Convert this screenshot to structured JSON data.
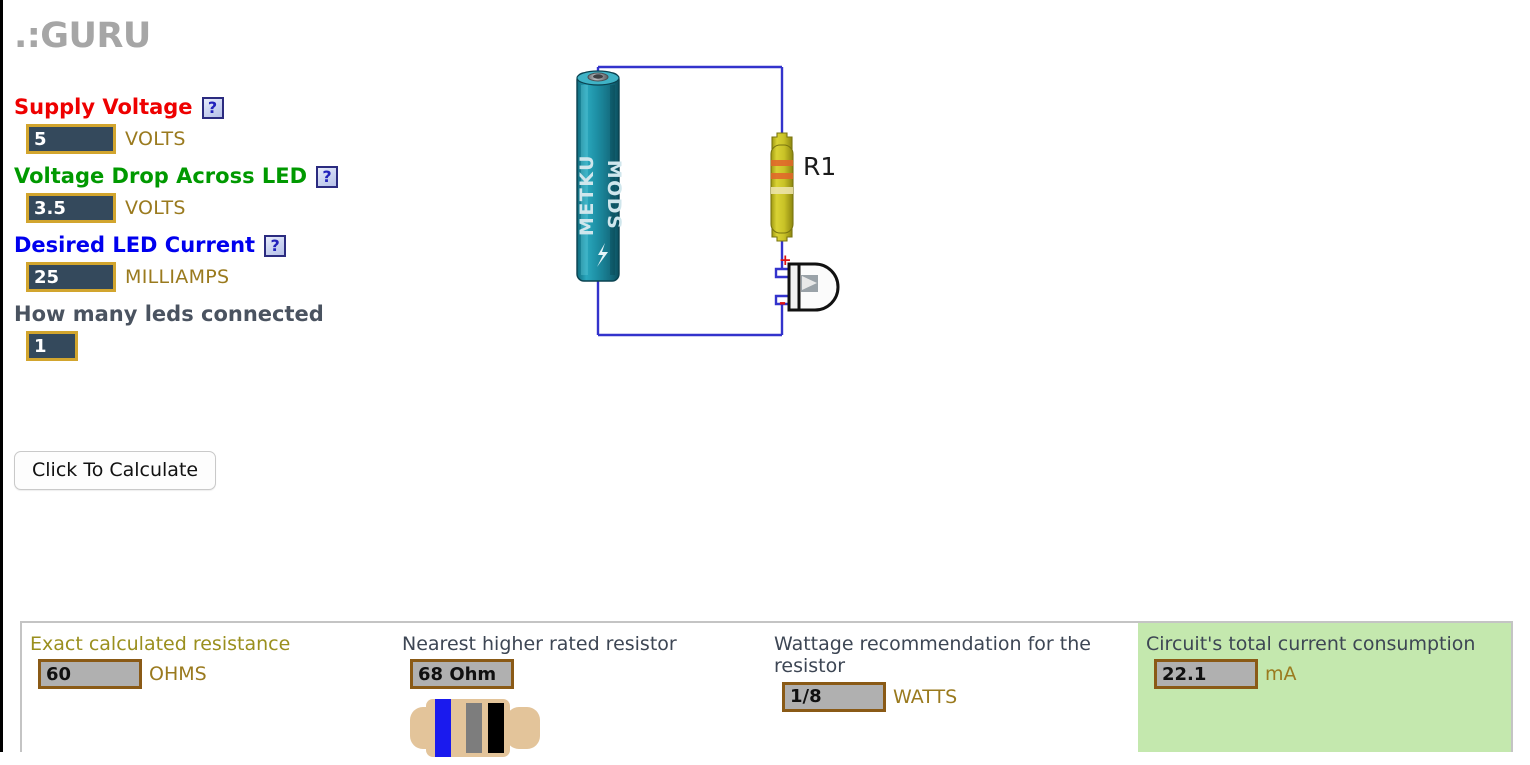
{
  "logo": {
    "text": ".:GURU"
  },
  "form": {
    "fields": [
      {
        "label": "Supply Voltage",
        "help_icon": "question-mark-icon",
        "help_text": "?",
        "value": "5",
        "unit": "VOLTS",
        "color": "#ee0000"
      },
      {
        "label": "Voltage Drop Across LED",
        "help_icon": "question-mark-icon",
        "help_text": "?",
        "value": "3.5",
        "unit": "VOLTS",
        "color": "#009900"
      },
      {
        "label": "Desired LED Current",
        "help_icon": "question-mark-icon",
        "help_text": "?",
        "value": "25",
        "unit": "MILLIAMPS",
        "color": "#0000ee"
      },
      {
        "label": "How many leds connected",
        "value": "1",
        "unit": "",
        "color": "#4a5360"
      }
    ],
    "calculate_button": "Click To Calculate"
  },
  "circuit": {
    "battery_label_line1": "METKU",
    "battery_label_line2": "MODS",
    "resistor_label": "R1",
    "led_plus": "+",
    "led_minus": "-",
    "wire_color": "#3333cc",
    "battery_color": "#1a8ca0",
    "resistor_color": "#ccc424"
  },
  "results": {
    "cells": [
      {
        "label": "Exact calculated resistance",
        "label_color": "#9a8f1e",
        "value": "60",
        "unit": "OHMS",
        "has_resistor_graphic": false,
        "background": "#ffffff"
      },
      {
        "label": "Nearest higher rated resistor",
        "label_color": "#3d4654",
        "value": "68 Ohm",
        "unit": "",
        "has_resistor_graphic": true,
        "band_colors": [
          "#1a1aee",
          "#7d7d7d",
          "#000000"
        ],
        "background": "#ffffff"
      },
      {
        "label": "Wattage recommendation for the resistor",
        "label_color": "#3d4654",
        "value": "1/8",
        "unit": "WATTS",
        "has_resistor_graphic": false,
        "background": "#ffffff"
      },
      {
        "label": "Circuit's total current consumption",
        "label_color": "#3d4654",
        "value": "22.1",
        "unit": "mA",
        "has_resistor_graphic": false,
        "background": "#c4e8ae"
      }
    ]
  }
}
